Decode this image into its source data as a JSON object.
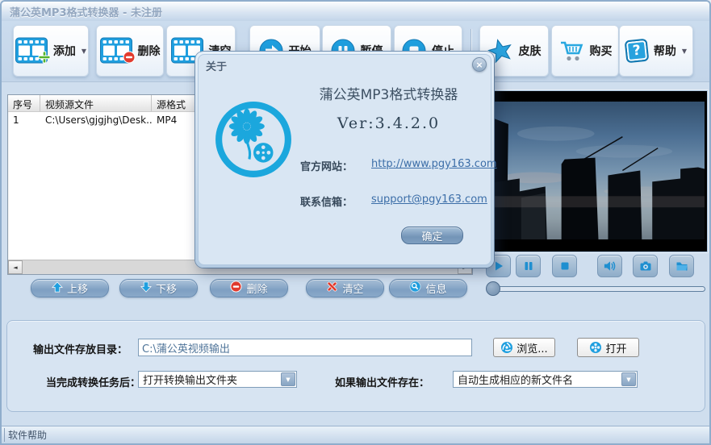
{
  "window": {
    "title": "蒲公英MP3格式转换器 - 未注册"
  },
  "icons": {
    "caret": "▼",
    "close": "×",
    "scroll_left": "◄",
    "scroll_right": "►",
    "help_glyph": "?"
  },
  "toolbar": {
    "add": "添加",
    "remove": "删除",
    "clear": "清空",
    "start": "开始",
    "pause": "暂停",
    "stop": "停止",
    "skin": "皮肤",
    "buy": "购买",
    "help": "帮助"
  },
  "file_table": {
    "columns": [
      "序号",
      "视频源文件",
      "源格式"
    ],
    "rows": [
      {
        "no": "1",
        "path": "C:\\Users\\gjgjhg\\Desk...",
        "format": "MP4"
      }
    ]
  },
  "list_actions": {
    "move_up": "上移",
    "move_down": "下移",
    "remove": "删除",
    "clear": "清空",
    "info": "信息"
  },
  "output_panel": {
    "dir_label": "输出文件存放目录：",
    "dir_value": "C:\\蒲公英视频输出",
    "browse": "浏览...",
    "open": "打开",
    "after_label": "当完成转换任务后：",
    "after_value": "打开转换输出文件夹",
    "exists_label": "如果输出文件存在：",
    "exists_value": "自动生成相应的新文件名"
  },
  "about_dialog": {
    "title": "关于",
    "app_name": "蒲公英MP3格式转换器",
    "version": "Ver:3.4.2.0",
    "website_label": "官方网站：",
    "website_url": "http://www.pgy163.com",
    "email_label": "联系信箱：",
    "email": "support@pgy163.com",
    "ok": "确定"
  },
  "statusbar": {
    "text": "软件帮助"
  },
  "colors": {
    "accent_cyan": "#1ba7dd",
    "steel_blue": "#7f9fc0",
    "link_blue": "#3c6ea8",
    "window_bg": "#cfdeee"
  }
}
